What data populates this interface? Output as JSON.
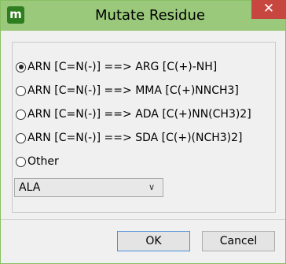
{
  "window": {
    "title": "Mutate Residue",
    "app_icon_letter": "m",
    "close_glyph": "✕"
  },
  "options": [
    {
      "label": "ARN [C=N(-)] ==> ARG [C(+)-NH]",
      "checked": true
    },
    {
      "label": "ARN [C=N(-)] ==> MMA [C(+)NNCH3]",
      "checked": false
    },
    {
      "label": "ARN [C=N(-)] ==> ADA [C(+)NN(CH3)2]",
      "checked": false
    },
    {
      "label": "ARN [C=N(-)] ==> SDA [C(+)(NCH3)2]",
      "checked": false
    },
    {
      "label": "Other",
      "checked": false
    }
  ],
  "residue_select": {
    "value": "ALA",
    "chevron_glyph": "∨"
  },
  "buttons": {
    "ok": "OK",
    "cancel": "Cancel"
  }
}
